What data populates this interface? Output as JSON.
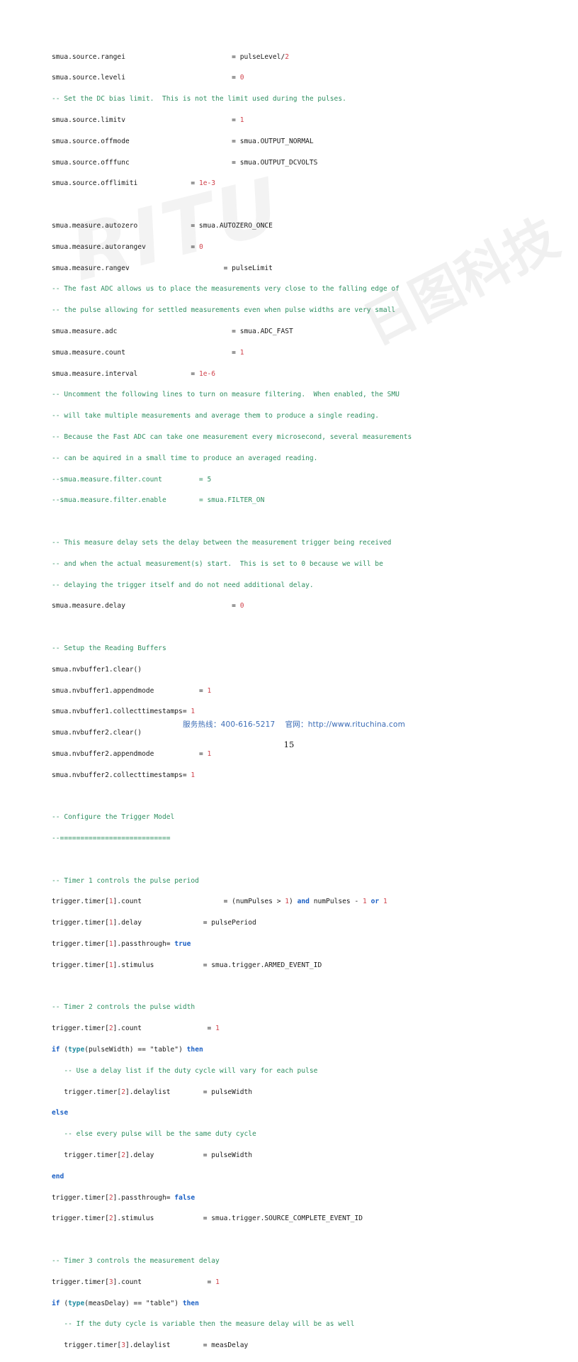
{
  "document": {
    "page_number": "15",
    "language": "lua"
  },
  "watermark": {
    "latin_text": "RITU",
    "cjk_text": "日图科技",
    "color": "#000000"
  },
  "footer": {
    "hotline_label": "服务热线：400-616-5217",
    "website_label": "官网：http://www.rituchina.com",
    "separator": "    ",
    "link_color": "#3a6bb5"
  },
  "palette": {
    "comment": "#2f8f62",
    "number": "#d0414a",
    "keyword": "#1a5fc4",
    "builtin": "#1f8ca0",
    "plain": "#1a1a1a"
  },
  "code": {
    "lines": [
      {
        "id": "l001",
        "segments": [
          {
            "t": "smua.source.rangei",
            "c": "pl"
          },
          {
            "t": "                          = pulseLevel/",
            "c": "pl"
          },
          {
            "t": "2",
            "c": "num"
          }
        ]
      },
      {
        "id": "l002",
        "segments": [
          {
            "t": "smua.source.leveli",
            "c": "pl"
          },
          {
            "t": "                          = ",
            "c": "pl"
          },
          {
            "t": "0",
            "c": "num"
          }
        ]
      },
      {
        "id": "l003",
        "segments": [
          {
            "t": "-- Set the DC bias limit.  This is not the limit used during the pulses.",
            "c": "cm"
          }
        ]
      },
      {
        "id": "l004",
        "segments": [
          {
            "t": "smua.source.limitv",
            "c": "pl"
          },
          {
            "t": "                          = ",
            "c": "pl"
          },
          {
            "t": "1",
            "c": "num"
          }
        ]
      },
      {
        "id": "l005",
        "segments": [
          {
            "t": "smua.source.offmode",
            "c": "pl"
          },
          {
            "t": "                         = smua.OUTPUT_NORMAL",
            "c": "pl"
          }
        ]
      },
      {
        "id": "l006",
        "segments": [
          {
            "t": "smua.source.offfunc",
            "c": "pl"
          },
          {
            "t": "                         = smua.OUTPUT_DCVOLTS",
            "c": "pl"
          }
        ]
      },
      {
        "id": "l007",
        "segments": [
          {
            "t": "smua.source.offlimiti",
            "c": "pl"
          },
          {
            "t": "             = ",
            "c": "pl"
          },
          {
            "t": "1e-3",
            "c": "num"
          }
        ]
      },
      {
        "id": "l008",
        "segments": []
      },
      {
        "id": "l009",
        "segments": [
          {
            "t": "smua.measure.autozero",
            "c": "pl"
          },
          {
            "t": "             = smua.AUTOZERO_ONCE",
            "c": "pl"
          }
        ]
      },
      {
        "id": "l010",
        "segments": [
          {
            "t": "smua.measure.autorangev",
            "c": "pl"
          },
          {
            "t": "           = ",
            "c": "pl"
          },
          {
            "t": "0",
            "c": "num"
          }
        ]
      },
      {
        "id": "l011",
        "segments": [
          {
            "t": "smua.measure.rangev",
            "c": "pl"
          },
          {
            "t": "                       = pulseLimit",
            "c": "pl"
          }
        ]
      },
      {
        "id": "l012",
        "segments": [
          {
            "t": "-- The fast ADC allows us to place the measurements very close to the falling edge of",
            "c": "cm"
          }
        ]
      },
      {
        "id": "l013",
        "segments": [
          {
            "t": "-- the pulse allowing for settled measurements even when pulse widths are very small",
            "c": "cm"
          }
        ]
      },
      {
        "id": "l014",
        "segments": [
          {
            "t": "smua.measure.adc",
            "c": "pl"
          },
          {
            "t": "                            = smua.ADC_FAST",
            "c": "pl"
          }
        ]
      },
      {
        "id": "l015",
        "segments": [
          {
            "t": "smua.measure.count",
            "c": "pl"
          },
          {
            "t": "                          = ",
            "c": "pl"
          },
          {
            "t": "1",
            "c": "num"
          }
        ]
      },
      {
        "id": "l016",
        "segments": [
          {
            "t": "smua.measure.interval",
            "c": "pl"
          },
          {
            "t": "             = ",
            "c": "pl"
          },
          {
            "t": "1e-6",
            "c": "num"
          }
        ]
      },
      {
        "id": "l017",
        "segments": [
          {
            "t": "-- Uncomment the following lines to turn on measure filtering.  When enabled, the SMU",
            "c": "cm"
          }
        ]
      },
      {
        "id": "l018",
        "segments": [
          {
            "t": "-- will take multiple measurements and average them to produce a single reading.",
            "c": "cm"
          }
        ]
      },
      {
        "id": "l019",
        "segments": [
          {
            "t": "-- Because the Fast ADC can take one measurement every microsecond, several measurements",
            "c": "cm"
          }
        ]
      },
      {
        "id": "l020",
        "segments": [
          {
            "t": "-- can be aquired in a small time to produce an averaged reading.",
            "c": "cm"
          }
        ]
      },
      {
        "id": "l021",
        "segments": [
          {
            "t": "--smua.measure.filter.count",
            "c": "cm"
          },
          {
            "t": "         = 5",
            "c": "cm"
          }
        ]
      },
      {
        "id": "l022",
        "segments": [
          {
            "t": "--smua.measure.filter.enable",
            "c": "cm"
          },
          {
            "t": "        = smua.FILTER_ON",
            "c": "cm"
          }
        ]
      },
      {
        "id": "l023",
        "segments": []
      },
      {
        "id": "l024",
        "segments": [
          {
            "t": "-- This measure delay sets the delay between the measurement trigger being received",
            "c": "cm"
          }
        ]
      },
      {
        "id": "l025",
        "segments": [
          {
            "t": "-- and when the actual measurement(s) start.  This is set to 0 because we will be",
            "c": "cm"
          }
        ]
      },
      {
        "id": "l026",
        "segments": [
          {
            "t": "-- delaying the trigger itself and do not need additional delay.",
            "c": "cm"
          }
        ]
      },
      {
        "id": "l027",
        "segments": [
          {
            "t": "smua.measure.delay",
            "c": "pl"
          },
          {
            "t": "                          = ",
            "c": "pl"
          },
          {
            "t": "0",
            "c": "num"
          }
        ]
      },
      {
        "id": "l028",
        "segments": []
      },
      {
        "id": "l029",
        "segments": [
          {
            "t": "-- Setup the Reading Buffers",
            "c": "cm"
          }
        ]
      },
      {
        "id": "l030",
        "segments": [
          {
            "t": "smua.nvbuffer1.clear()",
            "c": "pl"
          }
        ]
      },
      {
        "id": "l031",
        "segments": [
          {
            "t": "smua.nvbuffer1.appendmode",
            "c": "pl"
          },
          {
            "t": "           = ",
            "c": "pl"
          },
          {
            "t": "1",
            "c": "num"
          }
        ]
      },
      {
        "id": "l032",
        "segments": [
          {
            "t": "smua.nvbuffer1.collecttimestamps= ",
            "c": "pl"
          },
          {
            "t": "1",
            "c": "num"
          }
        ]
      },
      {
        "id": "l033",
        "segments": [
          {
            "t": "smua.nvbuffer2.clear()",
            "c": "pl"
          }
        ]
      },
      {
        "id": "l034",
        "segments": [
          {
            "t": "smua.nvbuffer2.appendmode",
            "c": "pl"
          },
          {
            "t": "           = ",
            "c": "pl"
          },
          {
            "t": "1",
            "c": "num"
          }
        ]
      },
      {
        "id": "l035",
        "segments": [
          {
            "t": "smua.nvbuffer2.collecttimestamps= ",
            "c": "pl"
          },
          {
            "t": "1",
            "c": "num"
          }
        ]
      },
      {
        "id": "l036",
        "segments": []
      },
      {
        "id": "l037",
        "segments": [
          {
            "t": "-- Configure the Trigger Model",
            "c": "cm"
          }
        ]
      },
      {
        "id": "l038",
        "segments": [
          {
            "t": "--===========================",
            "c": "cm"
          }
        ]
      },
      {
        "id": "l039",
        "segments": []
      },
      {
        "id": "l040",
        "segments": [
          {
            "t": "-- Timer 1 controls the pulse period",
            "c": "cm"
          }
        ]
      },
      {
        "id": "l041",
        "segments": [
          {
            "t": "trigger.timer[",
            "c": "pl"
          },
          {
            "t": "1",
            "c": "num"
          },
          {
            "t": "].count",
            "c": "pl"
          },
          {
            "t": "                    = (numPulses > ",
            "c": "pl"
          },
          {
            "t": "1",
            "c": "num"
          },
          {
            "t": ") ",
            "c": "pl"
          },
          {
            "t": "and",
            "c": "kw"
          },
          {
            "t": " numPulses - ",
            "c": "pl"
          },
          {
            "t": "1",
            "c": "num"
          },
          {
            "t": " ",
            "c": "pl"
          },
          {
            "t": "or",
            "c": "kw"
          },
          {
            "t": " ",
            "c": "pl"
          },
          {
            "t": "1",
            "c": "num"
          }
        ]
      },
      {
        "id": "l042",
        "segments": [
          {
            "t": "trigger.timer[",
            "c": "pl"
          },
          {
            "t": "1",
            "c": "num"
          },
          {
            "t": "].delay",
            "c": "pl"
          },
          {
            "t": "               = pulsePeriod",
            "c": "pl"
          }
        ]
      },
      {
        "id": "l043",
        "segments": [
          {
            "t": "trigger.timer[",
            "c": "pl"
          },
          {
            "t": "1",
            "c": "num"
          },
          {
            "t": "].passthrough= ",
            "c": "pl"
          },
          {
            "t": "true",
            "c": "kw"
          }
        ]
      },
      {
        "id": "l044",
        "segments": [
          {
            "t": "trigger.timer[",
            "c": "pl"
          },
          {
            "t": "1",
            "c": "num"
          },
          {
            "t": "].stimulus",
            "c": "pl"
          },
          {
            "t": "            = smua.trigger.ARMED_EVENT_ID",
            "c": "pl"
          }
        ]
      },
      {
        "id": "l045",
        "segments": []
      },
      {
        "id": "l046",
        "segments": [
          {
            "t": "-- Timer 2 controls the pulse width",
            "c": "cm"
          }
        ]
      },
      {
        "id": "l047",
        "segments": [
          {
            "t": "trigger.timer[",
            "c": "pl"
          },
          {
            "t": "2",
            "c": "num"
          },
          {
            "t": "].count",
            "c": "pl"
          },
          {
            "t": "                = ",
            "c": "pl"
          },
          {
            "t": "1",
            "c": "num"
          }
        ]
      },
      {
        "id": "l048",
        "segments": [
          {
            "t": "if",
            "c": "kw"
          },
          {
            "t": " (",
            "c": "pl"
          },
          {
            "t": "type",
            "c": "fn"
          },
          {
            "t": "(pulseWidth) == \"table\") ",
            "c": "pl"
          },
          {
            "t": "then",
            "c": "kw"
          }
        ]
      },
      {
        "id": "l049",
        "segments": [
          {
            "t": "   -- Use a delay list if the duty cycle will vary for each pulse",
            "c": "cm"
          }
        ]
      },
      {
        "id": "l050",
        "segments": [
          {
            "t": "   trigger.timer[",
            "c": "pl"
          },
          {
            "t": "2",
            "c": "num"
          },
          {
            "t": "].delaylist",
            "c": "pl"
          },
          {
            "t": "        = pulseWidth",
            "c": "pl"
          }
        ]
      },
      {
        "id": "l051",
        "segments": [
          {
            "t": "else",
            "c": "kw"
          }
        ]
      },
      {
        "id": "l052",
        "segments": [
          {
            "t": "   -- else every pulse will be the same duty cycle",
            "c": "cm"
          }
        ]
      },
      {
        "id": "l053",
        "segments": [
          {
            "t": "   trigger.timer[",
            "c": "pl"
          },
          {
            "t": "2",
            "c": "num"
          },
          {
            "t": "].delay",
            "c": "pl"
          },
          {
            "t": "            = pulseWidth",
            "c": "pl"
          }
        ]
      },
      {
        "id": "l054",
        "segments": [
          {
            "t": "end",
            "c": "kw"
          }
        ]
      },
      {
        "id": "l055",
        "segments": [
          {
            "t": "trigger.timer[",
            "c": "pl"
          },
          {
            "t": "2",
            "c": "num"
          },
          {
            "t": "].passthrough= ",
            "c": "pl"
          },
          {
            "t": "false",
            "c": "kw"
          }
        ]
      },
      {
        "id": "l056",
        "segments": [
          {
            "t": "trigger.timer[",
            "c": "pl"
          },
          {
            "t": "2",
            "c": "num"
          },
          {
            "t": "].stimulus",
            "c": "pl"
          },
          {
            "t": "            = smua.trigger.SOURCE_COMPLETE_EVENT_ID",
            "c": "pl"
          }
        ]
      },
      {
        "id": "l057",
        "segments": []
      },
      {
        "id": "l058",
        "segments": [
          {
            "t": "-- Timer 3 controls the measurement delay",
            "c": "cm"
          }
        ]
      },
      {
        "id": "l059",
        "segments": [
          {
            "t": "trigger.timer[",
            "c": "pl"
          },
          {
            "t": "3",
            "c": "num"
          },
          {
            "t": "].count",
            "c": "pl"
          },
          {
            "t": "                = ",
            "c": "pl"
          },
          {
            "t": "1",
            "c": "num"
          }
        ]
      },
      {
        "id": "l060",
        "segments": [
          {
            "t": "if",
            "c": "kw"
          },
          {
            "t": " (",
            "c": "pl"
          },
          {
            "t": "type",
            "c": "fn"
          },
          {
            "t": "(measDelay) == \"table\") ",
            "c": "pl"
          },
          {
            "t": "then",
            "c": "kw"
          }
        ]
      },
      {
        "id": "l061",
        "segments": [
          {
            "t": "   -- If the duty cycle is variable then the measure delay will be as well",
            "c": "cm"
          }
        ]
      },
      {
        "id": "l062",
        "segments": [
          {
            "t": "   trigger.timer[",
            "c": "pl"
          },
          {
            "t": "3",
            "c": "num"
          },
          {
            "t": "].delaylist",
            "c": "pl"
          },
          {
            "t": "        = measDelay",
            "c": "pl"
          }
        ]
      }
    ]
  }
}
